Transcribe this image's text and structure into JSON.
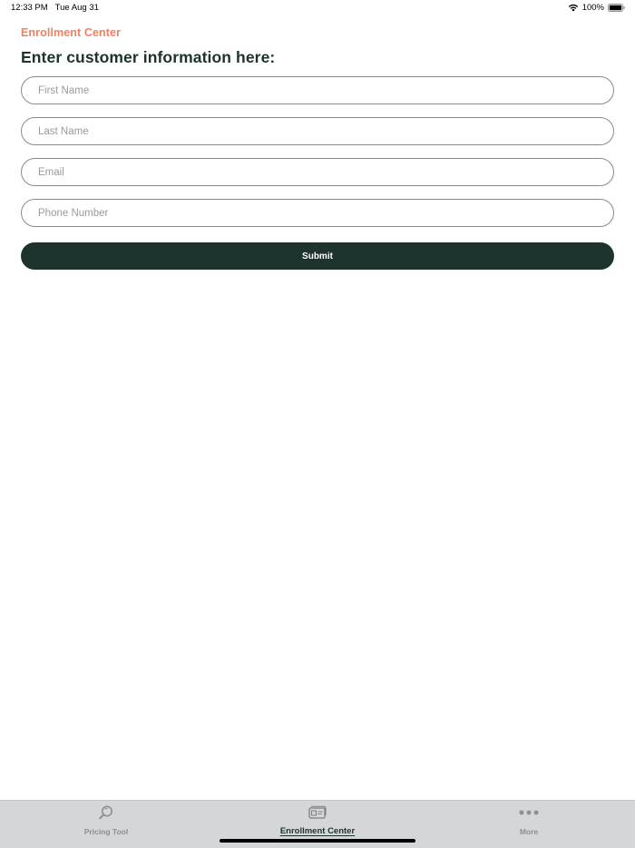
{
  "status_bar": {
    "time": "12:33 PM",
    "date": "Tue Aug 31",
    "battery": "100%"
  },
  "header": {
    "nav_title": "Enrollment Center",
    "page_title": "Enter customer information here:"
  },
  "form": {
    "first_name": {
      "placeholder": "First Name",
      "value": ""
    },
    "last_name": {
      "placeholder": "Last Name",
      "value": ""
    },
    "email": {
      "placeholder": "Email",
      "value": ""
    },
    "phone": {
      "placeholder": "Phone Number",
      "value": ""
    },
    "submit_label": "Submit"
  },
  "tab_bar": {
    "tabs": [
      {
        "label": "Pricing Tool",
        "icon": "search-icon",
        "active": false
      },
      {
        "label": "Enrollment Center",
        "icon": "id-card-icon",
        "active": true
      },
      {
        "label": "More",
        "icon": "more-dots-icon",
        "active": false
      }
    ]
  },
  "colors": {
    "accent_orange": "#f08160",
    "brand_dark_green": "#1c332e",
    "tab_bar_background": "#d4d6d9",
    "inactive_gray": "#8d8f91"
  }
}
